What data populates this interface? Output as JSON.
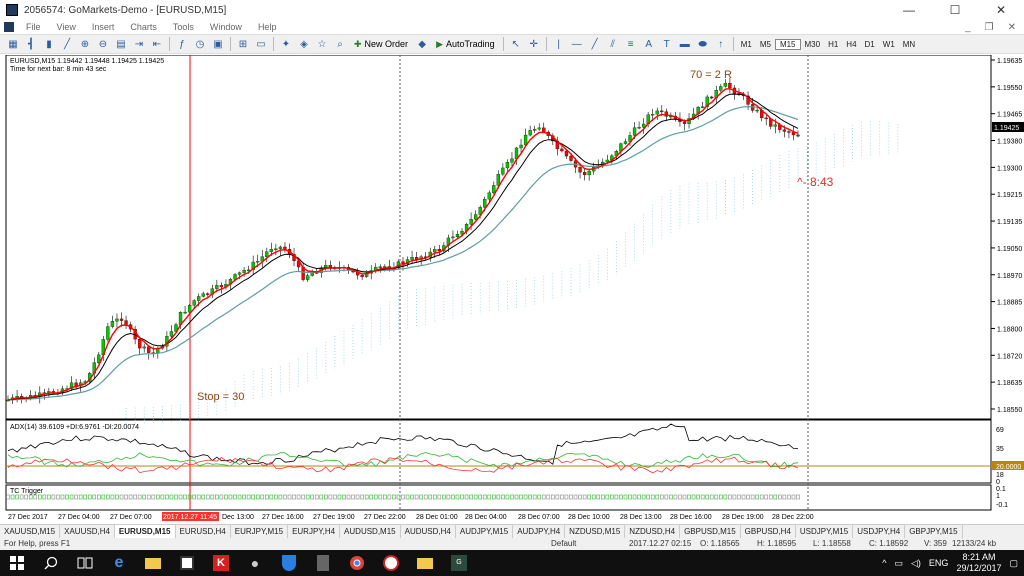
{
  "window": {
    "title": "2056574: GoMarkets-Demo - [EURUSD,M15]",
    "minimize": "—",
    "maximize": "☐",
    "close": "✕"
  },
  "menu": {
    "items": [
      "File",
      "View",
      "Insert",
      "Charts",
      "Tools",
      "Window",
      "Help"
    ],
    "right": {
      "minimize": "_",
      "restore": "❐",
      "close": "✕"
    }
  },
  "toolbar": {
    "new_order": "New Order",
    "autotrading": "AutoTrading",
    "timeframes": [
      "M1",
      "M5",
      "M15",
      "M30",
      "H1",
      "H4",
      "D1",
      "W1",
      "MN"
    ],
    "active_timeframe": "M15",
    "draw_text": "A",
    "draw_label": "T"
  },
  "chart": {
    "header_line1": "EURUSD,M15  1.19442 1.19448 1.19425 1.19425",
    "header_line2": "Time for next bar: 8 min 43 sec",
    "annotation_top": "70 = 2 R",
    "annotation_stop": "Stop = 30",
    "annotation_time": "^- 8:43",
    "price_levels": [
      "1.19635",
      "1.19550",
      "1.19465",
      "1.19380",
      "1.19300",
      "1.19215",
      "1.19135",
      "1.19050",
      "1.18970",
      "1.18885",
      "1.18800",
      "1.18720",
      "1.18635",
      "1.18550"
    ],
    "current_price": "1.19425",
    "adx_label": "ADX(14) 39.6109 +DI:6.9761 -DI:20.0074",
    "adx_levels": [
      "69",
      "35",
      "20.0000",
      "18",
      "0"
    ],
    "tc_label": "TC Trigger",
    "tc_levels": [
      "0.1",
      "1",
      "-0.1"
    ],
    "time_labels": [
      "27 Dec 2017",
      "27 Dec 04:00",
      "27 Dec 07:00",
      "2017.12.27 11:45",
      "Dec 13:00",
      "27 Dec 16:00",
      "27 Dec 19:00",
      "27 Dec 22:00",
      "28 Dec 01:00",
      "28 Dec 04:00",
      "28 Dec 07:00",
      "28 Dec 10:00",
      "28 Dec 13:00",
      "28 Dec 16:00",
      "28 Dec 19:00",
      "28 Dec 22:00"
    ]
  },
  "tabs": [
    "XAUUSD,M15",
    "XAUUSD,H4",
    "EURUSD,M15",
    "EURUSD,H4",
    "EURJPY,M15",
    "EURJPY,H4",
    "AUDUSD,M15",
    "AUDUSD,H4",
    "AUDJPY,M15",
    "AUDJPY,H4",
    "NZDUSD,M15",
    "NZDUSD,H4",
    "GBPUSD,M15",
    "GBPUSD,H4",
    "USDJPY,M15",
    "USDJPY,H4",
    "GBPJPY,M15"
  ],
  "active_tab": "EURUSD,M15",
  "status": {
    "help": "For Help, press F1",
    "profile": "Default",
    "datetime": "2017.12.27 02:15",
    "open": "O: 1.18565",
    "high": "H: 1.18595",
    "low": "L: 1.18558",
    "close": "C: 1.18592",
    "volume": "V: 359",
    "traffic": "12133/24 kb"
  },
  "taskbar": {
    "lang": "ENG",
    "time": "8:21 AM",
    "date": "29/12/2017"
  },
  "colors": {
    "bull": "#00c800",
    "bear": "#ff0000",
    "ma_fast": "#ff0000",
    "ma_mid": "#000000",
    "ma_slow": "#5f9ea0",
    "cloud_up": "#87ceeb",
    "cloud_down": "#da70d6",
    "annotation": "#8b4513"
  }
}
